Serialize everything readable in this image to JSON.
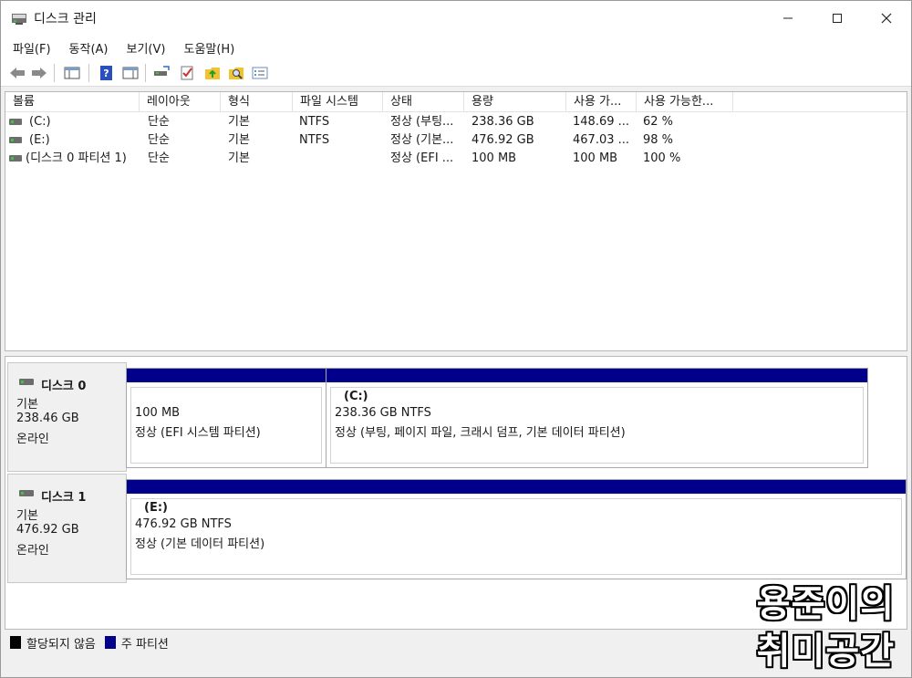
{
  "window": {
    "title": "디스크 관리",
    "controls": {
      "minimize": "—",
      "maximize": "☐",
      "close": "✕"
    }
  },
  "menu": [
    "파일(F)",
    "동작(A)",
    "보기(V)",
    "도움말(H)"
  ],
  "toolbar": {
    "icons": [
      "back-icon",
      "forward-icon",
      "show-console-tree-icon",
      "help-icon",
      "show-action-pane-icon",
      "connect-icon",
      "check-icon",
      "up-folder-icon",
      "search-icon",
      "properties-icon"
    ]
  },
  "volume_list": {
    "columns": [
      "볼륨",
      "레이아웃",
      "형식",
      "파일 시스템",
      "상태",
      "용량",
      "사용 가...",
      "사용 가능한..."
    ],
    "rows": [
      {
        "volume": "(C:)",
        "layout": "단순",
        "type": "기본",
        "fs": "NTFS",
        "status": "정상 (부팅...",
        "capacity": "238.36 GB",
        "free": "148.69 ...",
        "percent": "62 %"
      },
      {
        "volume": "(E:)",
        "layout": "단순",
        "type": "기본",
        "fs": "NTFS",
        "status": "정상 (기본...",
        "capacity": "476.92 GB",
        "free": "467.03 ...",
        "percent": "98 %"
      },
      {
        "volume": "(디스크 0 파티션 1)",
        "layout": "단순",
        "type": "기본",
        "fs": "",
        "status": "정상 (EFI ...",
        "capacity": "100 MB",
        "free": "100 MB",
        "percent": "100 %"
      }
    ]
  },
  "disks": [
    {
      "name": "디스크 0",
      "type": "기본",
      "size": "238.46 GB",
      "state": "온라인",
      "partitions": [
        {
          "label": "",
          "size": "100 MB",
          "status": "정상 (EFI 시스템 파티션)"
        },
        {
          "label": "(C:)",
          "size": "238.36 GB NTFS",
          "status": "정상 (부팅, 페이지 파일, 크래시 덤프, 기본 데이터 파티션)"
        }
      ]
    },
    {
      "name": "디스크 1",
      "type": "기본",
      "size": "476.92 GB",
      "state": "온라인",
      "partitions": [
        {
          "label": "(E:)",
          "size": "476.92 GB NTFS",
          "status": "정상 (기본 데이터 파티션)"
        }
      ]
    }
  ],
  "legend": {
    "items": [
      {
        "label": "할당되지 않음",
        "color": "#000000"
      },
      {
        "label": "주 파티션",
        "color": "#00008b"
      }
    ]
  },
  "colors": {
    "primary_partition_bar": "#00008b"
  },
  "watermark": {
    "line1": "용준이의",
    "line2": "취미공간"
  }
}
